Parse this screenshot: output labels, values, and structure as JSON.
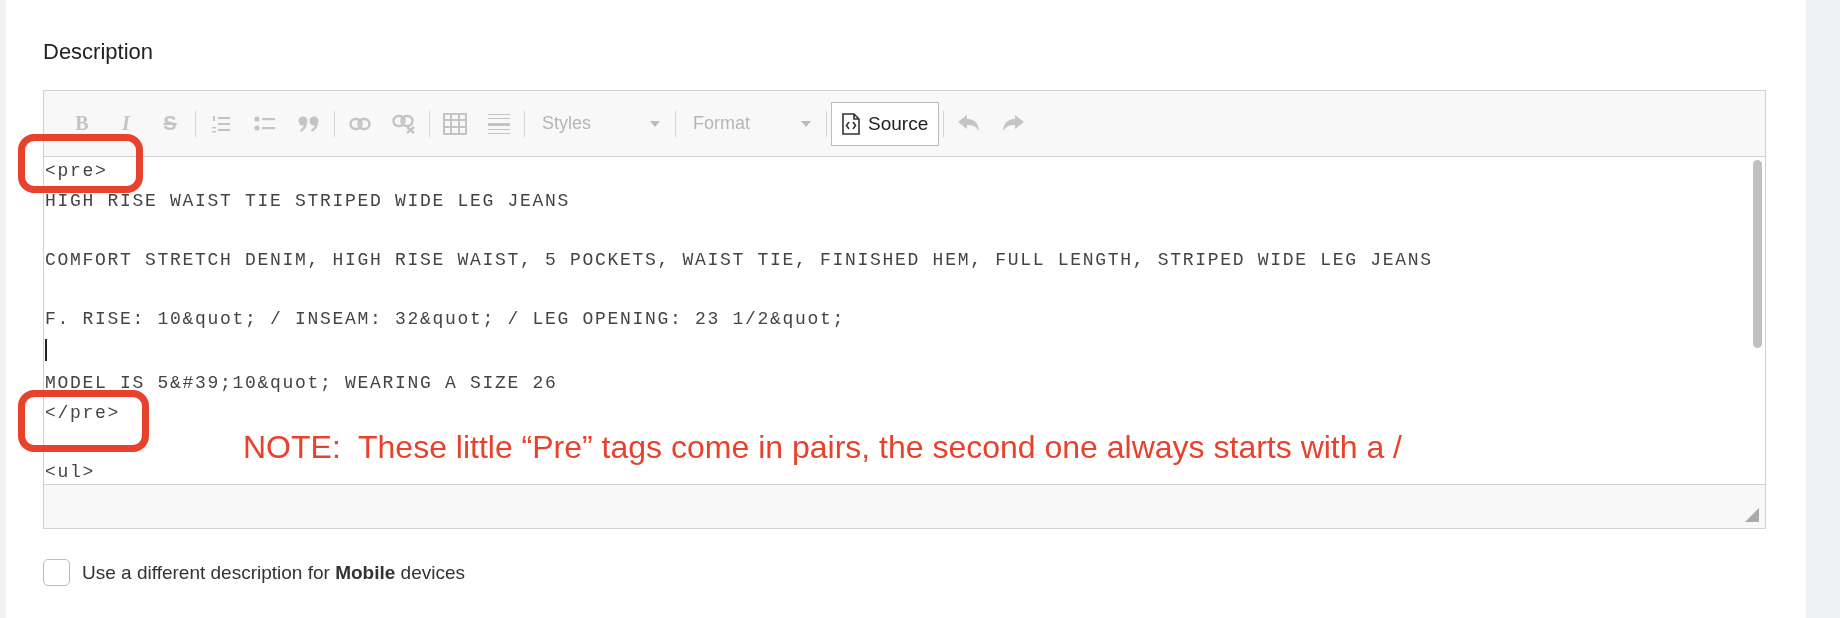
{
  "section": {
    "title": "Description"
  },
  "toolbar": [
    {
      "kind": "bold",
      "label": "B",
      "disabled": true
    },
    {
      "kind": "italic",
      "label": "I",
      "disabled": true
    },
    {
      "kind": "strike",
      "label": "S",
      "disabled": true
    },
    {
      "kind": "separator"
    },
    {
      "kind": "numbered-list",
      "disabled": true
    },
    {
      "kind": "bullet-list",
      "disabled": true
    },
    {
      "kind": "quote",
      "disabled": true
    },
    {
      "kind": "separator"
    },
    {
      "kind": "link",
      "disabled": true
    },
    {
      "kind": "unlink",
      "disabled": true
    },
    {
      "kind": "separator"
    },
    {
      "kind": "table",
      "disabled": true
    },
    {
      "kind": "rule",
      "disabled": true
    },
    {
      "kind": "separator"
    },
    {
      "kind": "dropdown",
      "label": "Styles",
      "disabled": true
    },
    {
      "kind": "separator"
    },
    {
      "kind": "dropdown",
      "label": "Format",
      "disabled": true
    },
    {
      "kind": "separator"
    },
    {
      "kind": "source",
      "label": "Source",
      "disabled": false
    },
    {
      "kind": "separator"
    },
    {
      "kind": "undo",
      "disabled": true
    },
    {
      "kind": "redo",
      "disabled": true
    }
  ],
  "editor_lines": [
    {
      "kind": "text",
      "text": "<pre>"
    },
    {
      "kind": "text",
      "text": "HIGH RISE WAIST TIE STRIPED WIDE LEG JEANS"
    },
    {
      "kind": "blank"
    },
    {
      "kind": "text",
      "text": "COMFORT STRETCH DENIM, HIGH RISE WAIST, 5 POCKETS, WAIST TIE, FINISHED HEM, FULL LENGTH, STRIPED WIDE LEG JEANS"
    },
    {
      "kind": "blank"
    },
    {
      "kind": "text",
      "text": "F. RISE: 10&quot; / INSEAM: 32&quot; / LEG OPENING: 23 1/2&quot;"
    },
    {
      "kind": "caret"
    },
    {
      "kind": "text",
      "text": "MODEL IS 5&#39;10&quot; WEARING A SIZE 26"
    },
    {
      "kind": "text",
      "text": "</pre>"
    },
    {
      "kind": "blank"
    },
    {
      "kind": "text",
      "text": "<ul>"
    }
  ],
  "annotation": {
    "note": "NOTE:  These little “Pre” tags come in pairs, the second one always starts with a /"
  },
  "mobile_option": {
    "label": "Use a different description for **Mobile** devices",
    "checked": false
  }
}
